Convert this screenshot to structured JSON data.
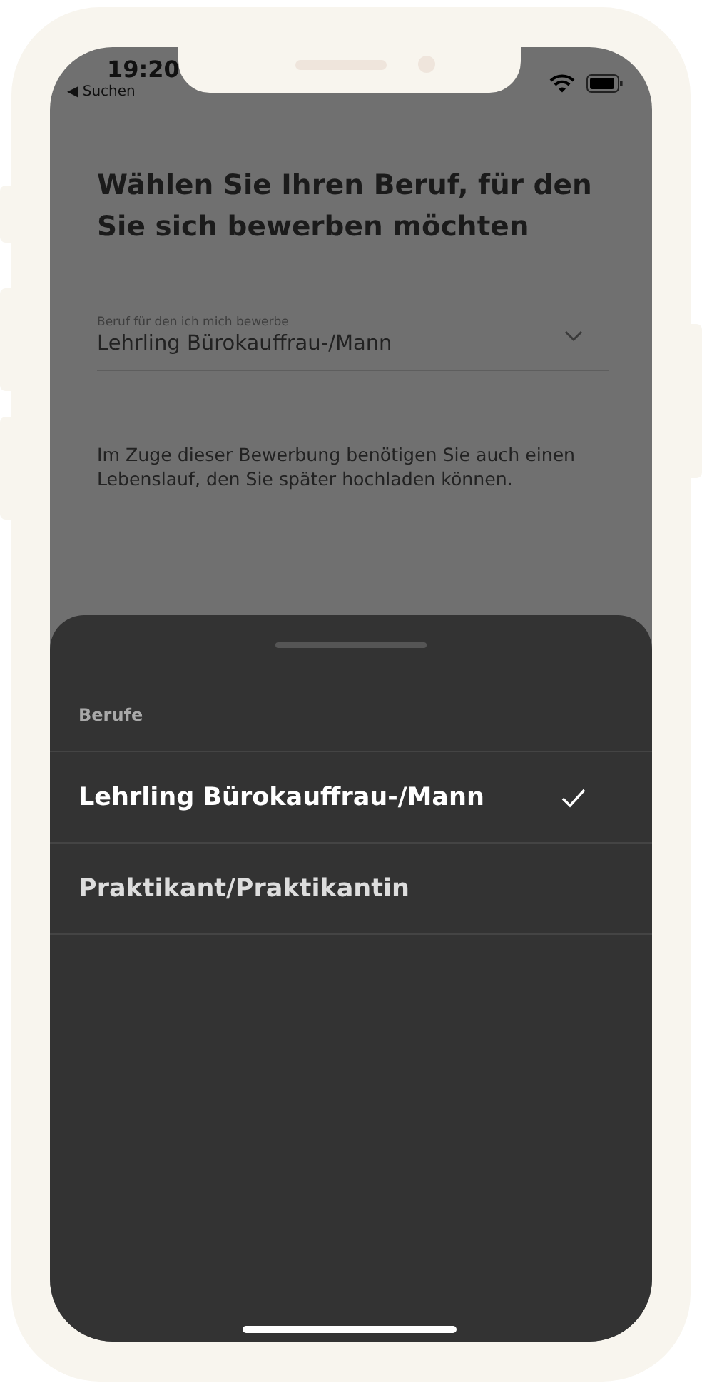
{
  "status_bar": {
    "time": "19:20",
    "back_label": "◀ Suchen"
  },
  "title": "Wählen Sie Ihren Beruf, für den Sie sich bewerben möchten",
  "field": {
    "label": "Beruf für den ich mich bewerbe",
    "value": "Lehrling Bürokauffrau-/Mann"
  },
  "note": "Im Zuge dieser Bewerbung benötigen Sie auch einen Lebenslauf, den Sie später hochladen können.",
  "sheet": {
    "title": "Berufe",
    "options": [
      {
        "label": "Lehrling Bürokauffrau-/Mann",
        "selected": true
      },
      {
        "label": "Praktikant/Praktikantin",
        "selected": false
      }
    ]
  }
}
